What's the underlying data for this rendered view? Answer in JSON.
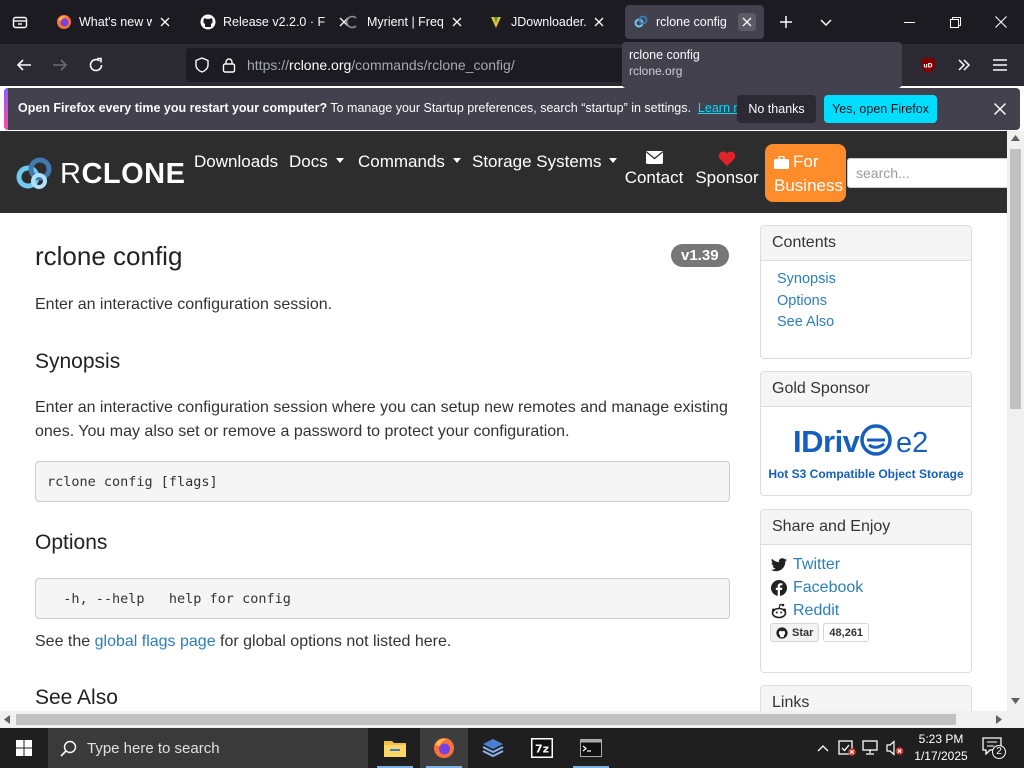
{
  "browser": {
    "tabs": [
      {
        "title": "What's new with Fi",
        "active": false
      },
      {
        "title": "Release v2.2.0 · F",
        "active": false
      },
      {
        "title": "Myrient | Freque",
        "active": false
      },
      {
        "title": "JDownloader.org",
        "active": false
      },
      {
        "title": "rclone config",
        "active": true
      }
    ],
    "url_prefix": "https://",
    "url_host": "rclone.org",
    "url_path": "/commands/rclone_config/",
    "tooltip": {
      "title": "rclone config",
      "host": "rclone.org"
    }
  },
  "notification": {
    "bold": "Open Firefox every time you restart your computer?",
    "text": " To manage your Startup preferences, search “startup” in settings.",
    "link": "Learn more",
    "no_button": "No thanks",
    "yes_button": "Yes, open Firefox"
  },
  "site": {
    "logo_r": "R",
    "logo_rest": "CLONE",
    "nav": {
      "downloads": "Downloads",
      "docs": "Docs",
      "commands": "Commands",
      "storage": "Storage Systems",
      "contact": "Contact",
      "sponsor": "Sponsor",
      "business_line1": "For",
      "business_line2": "Business"
    },
    "search_placeholder": "search..."
  },
  "content": {
    "title": "rclone config",
    "version": "v1.39",
    "intro": "Enter an interactive configuration session.",
    "synopsis_heading": "Synopsis",
    "synopsis_line1": "Enter an interactive configuration session where you can setup new remotes and manage existing",
    "synopsis_line2": "ones. You may also set or remove a password to protect your configuration.",
    "usage_code": "rclone config [flags]",
    "options_heading": "Options",
    "options_code": "  -h, --help   help for config",
    "global_before": "See the ",
    "global_link": "global flags page",
    "global_after": " for global options not listed here.",
    "see_also_heading": "See Also"
  },
  "sidebar": {
    "contents_title": "Contents",
    "contents": [
      "Synopsis",
      "Options",
      "See Also"
    ],
    "gold_title": "Gold Sponsor",
    "sponsor_logo": "IDrive e2",
    "sponsor_tagline": "Hot S3 Compatible Object Storage",
    "share_title": "Share and Enjoy",
    "share": {
      "twitter": "Twitter",
      "facebook": "Facebook",
      "reddit": "Reddit"
    },
    "github_star": "Star",
    "github_count": "48,261",
    "links_title": "Links"
  },
  "taskbar": {
    "search_placeholder": "Type here to search",
    "time": "5:23 PM",
    "date": "1/17/2025",
    "notifications": "2"
  },
  "colors": {
    "firefox_accent": "#00ddff",
    "site_nav_bg": "#2d2d2d",
    "business_orange": "#ff8c2a",
    "link_blue": "#2c7fba",
    "version_badge": "#777777"
  }
}
